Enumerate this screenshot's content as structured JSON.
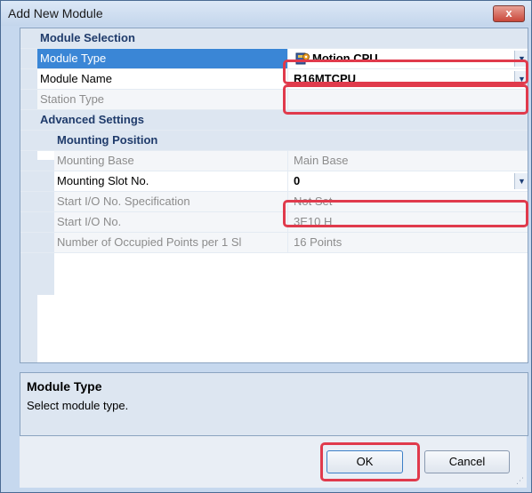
{
  "window": {
    "title": "Add New Module",
    "close_label": "x"
  },
  "grid": {
    "module_selection": {
      "label": "Module Selection",
      "module_type": {
        "name": "Module Type",
        "value": "Motion CPU",
        "icon": "motion-cpu-icon"
      },
      "module_name": {
        "name": "Module Name",
        "value": "R16MTCPU"
      },
      "station_type": {
        "name": "Station Type",
        "value": ""
      }
    },
    "advanced_settings": {
      "label": "Advanced Settings",
      "mounting_position": {
        "label": "Mounting Position",
        "mounting_base": {
          "name": "Mounting Base",
          "value": "Main Base"
        },
        "mounting_slot": {
          "name": "Mounting Slot No.",
          "value": "0"
        },
        "start_io_spec": {
          "name": "Start I/O No. Specification",
          "value": "Not Set"
        },
        "start_io": {
          "name": "Start I/O No.",
          "value": "3E10 H"
        },
        "occupied_points": {
          "name": "Number of Occupied Points per 1 Sl",
          "value": "16 Points"
        }
      }
    }
  },
  "description": {
    "title": "Module Type",
    "text": "Select module type."
  },
  "buttons": {
    "ok": "OK",
    "cancel": "Cancel"
  },
  "colors": {
    "highlight": "#e03a4c",
    "selected_row": "#3a86d6",
    "category_bg": "#dde6f1"
  }
}
